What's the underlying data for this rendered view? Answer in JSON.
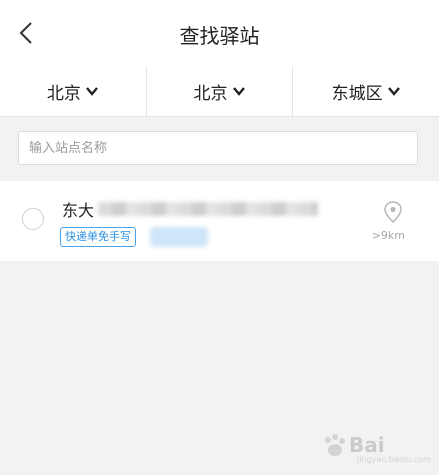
{
  "header": {
    "back_icon": "chevron-left-icon",
    "title": "查找驿站"
  },
  "filters": {
    "province": "北京",
    "city": "北京",
    "district": "东城区",
    "chevron_icon": "chevron-down-icon"
  },
  "search": {
    "placeholder": "输入站点名称",
    "value": ""
  },
  "stations": [
    {
      "name_prefix": "东大",
      "tag": "快递单免手写",
      "distance": ">9km",
      "location_icon": "map-pin-icon"
    }
  ],
  "watermark": {
    "text": "Bai",
    "sub": "jingyan.baidu.com"
  },
  "colors": {
    "accent": "#2d8fe0",
    "background": "#f2f2f2"
  }
}
